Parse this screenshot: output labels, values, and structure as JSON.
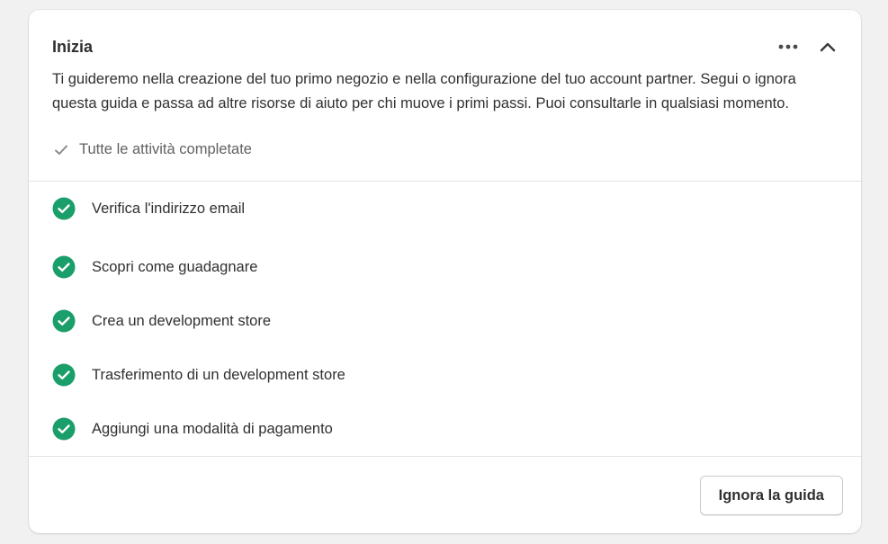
{
  "card": {
    "title": "Inizia",
    "description": "Ti guideremo nella creazione del tuo primo negozio e nella configurazione del tuo account partner. Segui o ignora questa guida e passa ad altre risorse di aiuto per chi muove i primi passi. Puoi consultarle in qualsiasi momento.",
    "status_text": "Tutte le attività completate",
    "icons": {
      "more": "more-horizontal-icon",
      "collapse": "chevron-up-icon",
      "status": "checkmark-icon",
      "task": "check-circle-icon"
    }
  },
  "tasks": [
    {
      "label": "Verifica l'indirizzo email",
      "completed": true
    },
    {
      "label": "Scopri come guadagnare",
      "completed": true
    },
    {
      "label": "Crea un development store",
      "completed": true
    },
    {
      "label": "Trasferimento di un development store",
      "completed": true
    },
    {
      "label": "Aggiungi una modalità di pagamento",
      "completed": true
    }
  ],
  "footer": {
    "dismiss_label": "Ignora la guida"
  },
  "colors": {
    "success": "#1a9e6a",
    "text": "#303030",
    "subdued": "#616161"
  }
}
